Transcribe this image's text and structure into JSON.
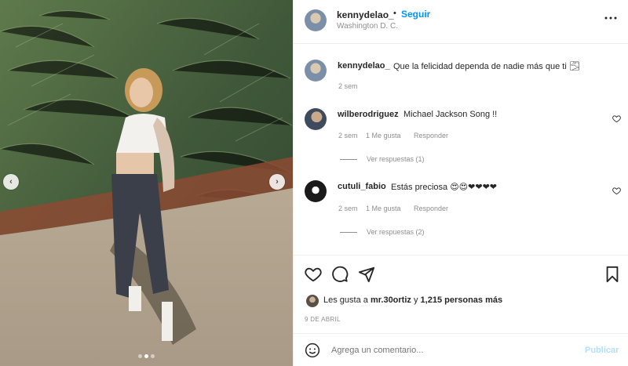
{
  "post": {
    "username": "kennydelao_",
    "location": "Washington D. C.",
    "follow_label": "Seguir",
    "dot_separator": "•",
    "more_icon": "more-horizontal-icon"
  },
  "caption": {
    "username": "kennydelao_",
    "text": "Que la felicidad dependa de nadie más que ti 🌫",
    "time": "2 sem"
  },
  "comments": [
    {
      "username": "wilberodriguez",
      "text": "Michael Jackson Song !!",
      "time": "2 sem",
      "likes": "1 Me gusta",
      "reply_label": "Responder",
      "view_replies": "Ver respuestas (1)"
    },
    {
      "username": "cutuli_fabio",
      "text": "Estás preciosa 😍😍❤❤❤❤",
      "time": "2 sem",
      "likes": "1 Me gusta",
      "reply_label": "Responder",
      "view_replies": "Ver respuestas (2)"
    }
  ],
  "likes": {
    "prefix": "Les gusta a",
    "user": "mr.30ortiz",
    "conj": "y",
    "others": "1,215 personas más"
  },
  "date": "9 DE ABRIL",
  "add_comment": {
    "placeholder": "Agrega un comentario...",
    "publish_label": "Publicar"
  },
  "carousel": {
    "prev_label": "‹",
    "next_label": "›"
  }
}
